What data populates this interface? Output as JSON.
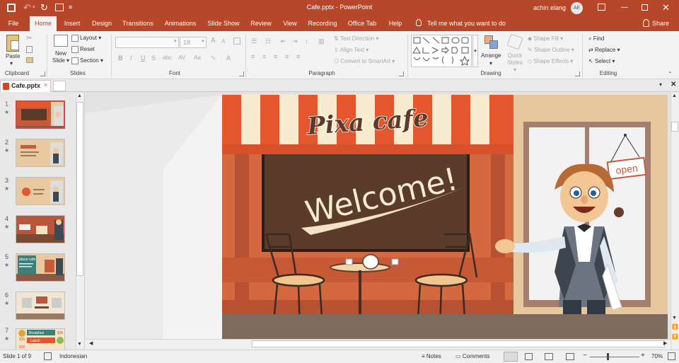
{
  "window": {
    "title": "Cafe.pptx  -  PowerPoint",
    "user_name": "achin elang",
    "user_initials": "AE"
  },
  "ribbon_tabs": [
    "File",
    "Home",
    "Insert",
    "Design",
    "Transitions",
    "Animations",
    "Slide Show",
    "Review",
    "View",
    "Recording",
    "Office Tab",
    "Help"
  ],
  "active_tab": "Home",
  "tell_me": "Tell me what you want to do",
  "share_label": "Share",
  "groups": {
    "clipboard": {
      "label": "Clipboard",
      "paste": "Paste"
    },
    "slides": {
      "label": "Slides",
      "new_slide": "New\nSlide",
      "layout": "Layout",
      "reset": "Reset",
      "section": "Section"
    },
    "font": {
      "label": "Font",
      "font_name": "",
      "font_size": "18"
    },
    "paragraph": {
      "label": "Paragraph",
      "text_direction": "Text Direction",
      "align_text": "Align Text",
      "convert_smartart": "Convert to SmartArt"
    },
    "drawing": {
      "label": "Drawing",
      "arrange": "Arrange",
      "quick_styles": "Quick\nStyles",
      "shape_fill": "Shape Fill",
      "shape_outline": "Shape Outline",
      "shape_effects": "Shape Effects"
    },
    "editing": {
      "label": "Editing",
      "find": "Find",
      "replace": "Replace",
      "select": "Select"
    }
  },
  "doc_tab": {
    "name": "Cafe.pptx"
  },
  "thumbnails": [
    {
      "num": "1",
      "star": "★"
    },
    {
      "num": "2",
      "star": "★"
    },
    {
      "num": "3",
      "star": "★"
    },
    {
      "num": "4",
      "star": "★"
    },
    {
      "num": "5",
      "star": "★"
    },
    {
      "num": "6",
      "star": "★"
    },
    {
      "num": "7",
      "star": "★"
    }
  ],
  "thumb_texts": {
    "t5_title": "about cafe",
    "t7_item1": "Breakfast",
    "t7_item2": "Lunch",
    "t7_price1": "$35",
    "t7_price2": "$35",
    "t7_price3": "$35"
  },
  "slide": {
    "cafe_name": "Pixa cafe",
    "welcome": "Welcome!",
    "sign": "open"
  },
  "status": {
    "slide_info": "Slide 1 of 9",
    "language": "Indonesian",
    "notes": "Notes",
    "comments": "Comments",
    "zoom": "70%"
  },
  "colors": {
    "accent": "#b7472a",
    "awning_red": "#e4572e",
    "awning_cream": "#f7ecd0",
    "wall": "#e8c9a0",
    "board": "#5b3b2a"
  }
}
